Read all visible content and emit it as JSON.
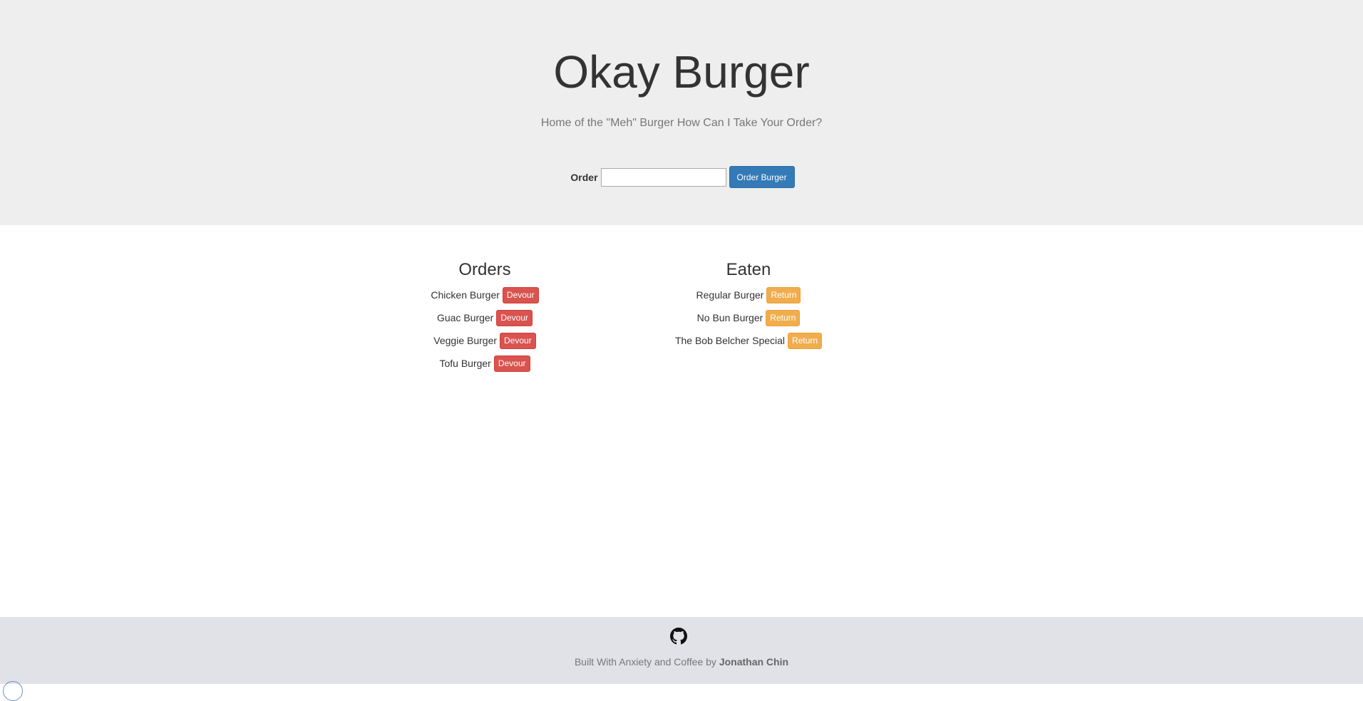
{
  "header": {
    "title": "Okay Burger",
    "subtitle": "Home of the \"Meh\" Burger How Can I Take Your Order?"
  },
  "order_form": {
    "label": "Order",
    "input_value": "",
    "button_label": "Order Burger"
  },
  "orders": {
    "heading": "Orders",
    "items": [
      {
        "name": "Chicken Burger",
        "action": "Devour"
      },
      {
        "name": "Guac Burger",
        "action": "Devour"
      },
      {
        "name": "Veggie Burger",
        "action": "Devour"
      },
      {
        "name": "Tofu Burger",
        "action": "Devour"
      }
    ]
  },
  "eaten": {
    "heading": "Eaten",
    "items": [
      {
        "name": "Regular Burger",
        "action": "Return"
      },
      {
        "name": "No Bun Burger",
        "action": "Return"
      },
      {
        "name": "The Bob Belcher Special",
        "action": "Return"
      }
    ]
  },
  "footer": {
    "icon": "github-icon",
    "text_prefix": "Built With Anxiety and Coffee by",
    "author": "Jonathan Chin"
  },
  "colors": {
    "primary": "#337ab7",
    "danger": "#d9534f",
    "warning": "#f0ad4e",
    "jumbotron_bg": "#eeeeee",
    "footer_bg": "#e0e2e8"
  }
}
